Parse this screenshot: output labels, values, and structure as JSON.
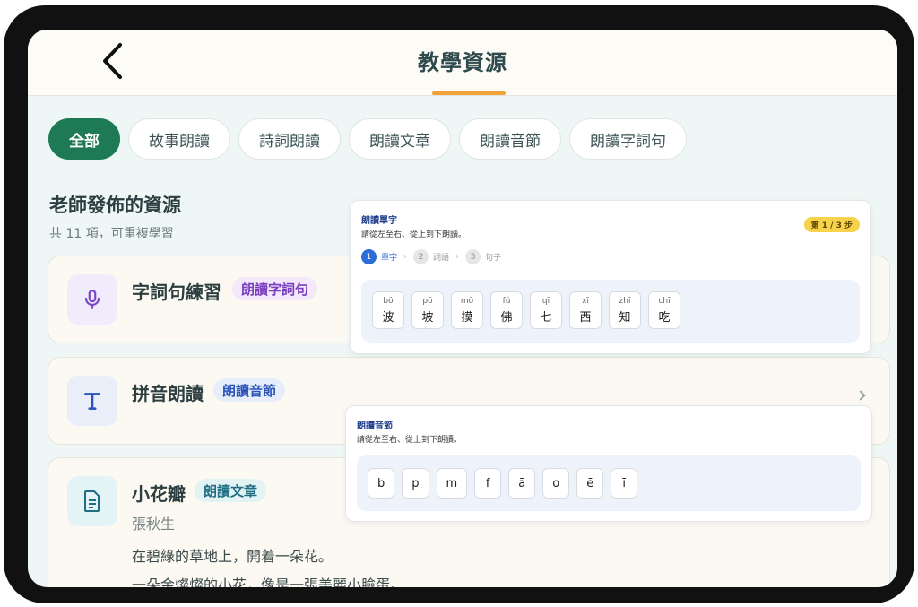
{
  "header": {
    "title": "教學資源"
  },
  "filters": [
    "全部",
    "故事朗讀",
    "詩詞朗讀",
    "朗讀文章",
    "朗讀音節",
    "朗讀字詞句"
  ],
  "section": {
    "title": "老師發佈的資源",
    "subtitle": "共 11 項，可重複學習"
  },
  "cards": [
    {
      "title": "字詞句練習",
      "badge": "朗讀字詞句",
      "icon": "microphone-icon"
    },
    {
      "title": "拼音朗讀",
      "badge": "朗讀音節",
      "icon": "text-t-icon"
    },
    {
      "title": "小花瓣",
      "badge": "朗讀文章",
      "author": "張秋生",
      "icon": "document-icon",
      "lines": [
        "在碧綠的草地上，開着一朵花。",
        "一朵金燦燦的小花，像是一張美麗小臉蛋。..."
      ]
    }
  ],
  "preview_words": {
    "title": "朗讀單字",
    "instruction": "請從左至右、從上到下朗讀。",
    "step_badge": "第 1 / 3 步",
    "steps": [
      {
        "num": "1",
        "label": "單字"
      },
      {
        "num": "2",
        "label": "詞語"
      },
      {
        "num": "3",
        "label": "句子"
      }
    ],
    "tiles": [
      {
        "py": "bō",
        "ch": "波"
      },
      {
        "py": "pō",
        "ch": "坡"
      },
      {
        "py": "mō",
        "ch": "摸"
      },
      {
        "py": "fú",
        "ch": "佛"
      },
      {
        "py": "qī",
        "ch": "七"
      },
      {
        "py": "xī",
        "ch": "西"
      },
      {
        "py": "zhī",
        "ch": "知"
      },
      {
        "py": "chī",
        "ch": "吃"
      }
    ]
  },
  "preview_syllables": {
    "title": "朗讀音節",
    "instruction": "請從左至右、從上到下朗讀。",
    "tiles": [
      "b",
      "p",
      "m",
      "f",
      "ā",
      "o",
      "ē",
      "ī"
    ]
  },
  "colors": {
    "accent": "#1d7a55",
    "underline": "#f2a23a",
    "step_badge": "#f7d24a",
    "blue": "#2b6fd6"
  }
}
